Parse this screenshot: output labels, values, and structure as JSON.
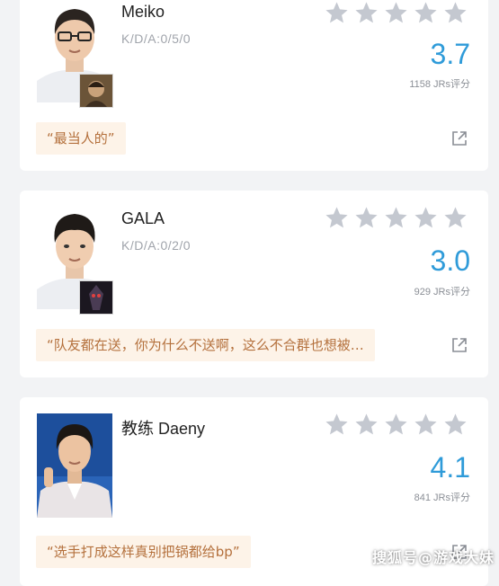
{
  "cards": [
    {
      "name": "Meiko",
      "kda": "K/D/A:0/5/0",
      "stars": 5,
      "score": "3.7",
      "ratings": "1158 JRs评分",
      "comment": "“最当人的”"
    },
    {
      "name": "GALA",
      "kda": "K/D/A:0/2/0",
      "stars": 5,
      "score": "3.0",
      "ratings": "929 JRs评分",
      "comment": "“队友都在送，你为什么不送啊，这么不合群也想被…"
    },
    {
      "name": "教练 Daeny",
      "kda": "",
      "stars": 5,
      "score": "4.1",
      "ratings": "841 JRs评分",
      "comment": "“选手打成这样真别把锅都给bp”"
    }
  ],
  "watermark": "搜狐号@游戏大妹",
  "colors": {
    "score": "#2f9bd9",
    "star": "#c4c8d0",
    "comment_bg": "#fdf3e8",
    "comment_text": "#b4703c"
  },
  "icons": [
    "star-icon",
    "share-icon"
  ]
}
